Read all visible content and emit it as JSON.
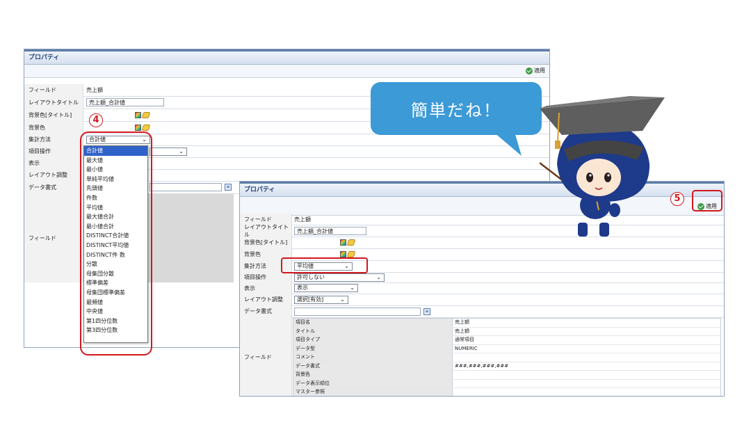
{
  "panel1": {
    "header": "プロパティ",
    "apply": "適用",
    "rows": {
      "field": {
        "label": "フィールド",
        "value": "売上額"
      },
      "layout_title": {
        "label": "レイアウトタイトル",
        "value": "売上額_合計値"
      },
      "bg_title": {
        "label": "背景色[タイトル]"
      },
      "bg": {
        "label": "背景色"
      },
      "agg": {
        "label": "集計方法",
        "value": "合計値"
      },
      "item_op": {
        "label": "項目操作"
      },
      "display": {
        "label": "表示"
      },
      "layout_adj": {
        "label": "レイアウト調整"
      },
      "data_format": {
        "label": "データ書式"
      },
      "field_block": {
        "label": "フィールド"
      }
    },
    "dropdown_options": [
      "合計値",
      "最大値",
      "最小値",
      "単純平均値",
      "先頭値",
      "件数",
      "平均値",
      "最大値合計",
      "最小値合計",
      "DISTINCT合計値",
      "DISTINCT平均値",
      "DISTINCT件 数",
      "分散",
      "母集団分散",
      "標準偏差",
      "母集団標準偏差",
      "最頻値",
      "中央値",
      "第1四分位数",
      "第3四分位数"
    ],
    "selected_option": "合計値"
  },
  "panel2": {
    "header": "プロパティ",
    "apply": "適用",
    "rows": {
      "field": {
        "label": "フィールド",
        "value": "売上額"
      },
      "layout_title": {
        "label": "レイアウトタイトル",
        "value": "売上額_合計値"
      },
      "bg_title": {
        "label": "背景色[タイトル]"
      },
      "bg": {
        "label": "背景色"
      },
      "agg": {
        "label": "集計方法",
        "value": "平均値"
      },
      "item_op": {
        "label": "項目操作",
        "value": "許可しない"
      },
      "display": {
        "label": "表示",
        "value": "表示"
      },
      "layout_adj": {
        "label": "レイアウト調整",
        "value": "選択[有効]"
      },
      "data_format": {
        "label": "データ書式"
      },
      "field_block": {
        "label": "フィールド"
      }
    },
    "field_table": [
      {
        "key": "項目名",
        "value": "売上額"
      },
      {
        "key": "タイトル",
        "value": "売上額"
      },
      {
        "key": "項目タイプ",
        "value": "通常項目"
      },
      {
        "key": "データ型",
        "value": "NUMERIC"
      },
      {
        "key": "コメント",
        "value": ""
      },
      {
        "key": "データ書式",
        "value": "###,###,###,###"
      },
      {
        "key": "背景色",
        "value": ""
      },
      {
        "key": "データ表示順位",
        "value": ""
      },
      {
        "key": "マスター参照",
        "value": ""
      }
    ]
  },
  "annotations": {
    "step4": "4",
    "step5": "5",
    "bubble": "簡単だね！"
  },
  "colors": {
    "accent_red": "#d0181f",
    "bubble_blue": "#3c9ad6",
    "highlight_blue": "#2f62c9"
  },
  "icons": [
    "check-circle-icon",
    "color-palette-icon",
    "eraser-icon",
    "format-icon",
    "chevron-down-icon"
  ]
}
